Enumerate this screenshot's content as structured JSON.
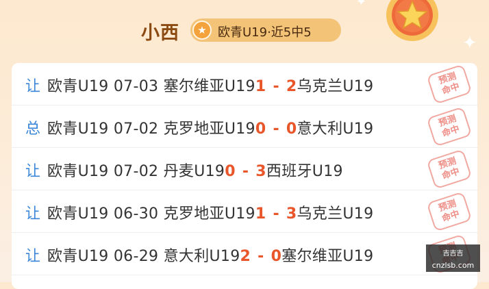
{
  "header": {
    "name": "小西",
    "pill_text": "欧青U19·近5中5",
    "medal_icon": "star-medal-icon"
  },
  "matches": [
    {
      "type": "让",
      "date_line": "欧青U19 07-03 ",
      "home": "塞尔维亚U19",
      "home_score": "1",
      "dash": "-",
      "away_score": "2",
      "away": "乌克兰U19",
      "stamp_line1": "预测",
      "stamp_line2": "命中"
    },
    {
      "type": "总",
      "date_line": "欧青U19 07-02 ",
      "home": "克罗地亚U19",
      "home_score": "0",
      "dash": "-",
      "away_score": "0",
      "away": "意大利U19",
      "stamp_line1": "预测",
      "stamp_line2": "命中"
    },
    {
      "type": "让",
      "date_line": "欧青U19 07-02 ",
      "home": "丹麦U19",
      "home_score": "0",
      "dash": "-",
      "away_score": "3",
      "away": "西班牙U19",
      "stamp_line1": "预测",
      "stamp_line2": "命中"
    },
    {
      "type": "让",
      "date_line": "欧青U19 06-30 ",
      "home": "克罗地亚U19",
      "home_score": "1",
      "dash": "-",
      "away_score": "3",
      "away": "乌克兰U19",
      "stamp_line1": "预测",
      "stamp_line2": "命中"
    },
    {
      "type": "让",
      "date_line": "欧青U19 06-29 ",
      "home": "意大利U19",
      "home_score": "2",
      "dash": "-",
      "away_score": "0",
      "away": "塞尔维亚U19",
      "stamp_line1": "预测",
      "stamp_line2": "命中"
    }
  ],
  "watermark": {
    "line1": "吉吉吉",
    "line2": "cnzlsb.com"
  },
  "colors": {
    "accent_score": "#e8562a",
    "type_label": "#3a86d8",
    "stamp": "#ee8e86",
    "name": "#8a4a12"
  }
}
